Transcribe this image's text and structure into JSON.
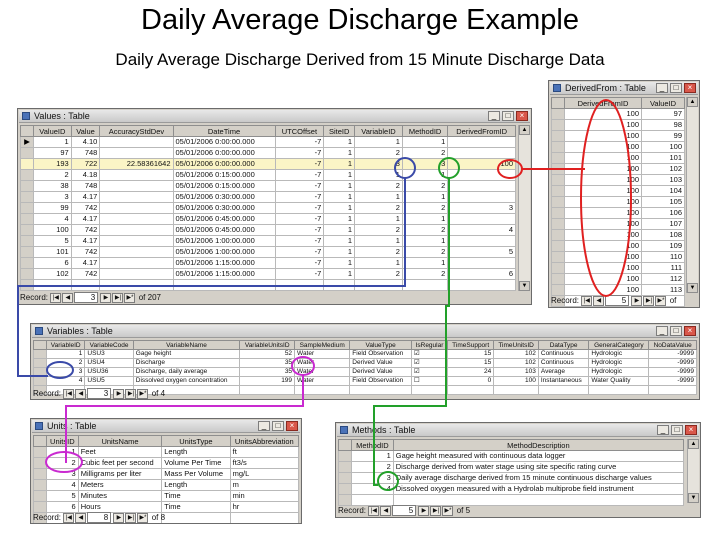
{
  "slide": {
    "title": "Daily Average Discharge Example",
    "subtitle": "Daily Average Discharge Derived from 15 Minute Discharge Data"
  },
  "colors": {
    "red": "#e02020",
    "blue": "#3a4aa8",
    "green": "#22a02a",
    "magenta": "#c92ad0",
    "highlight": "#fbf5c6"
  },
  "values_table": {
    "title": "Values : Table",
    "columns": [
      "ValueID",
      "Value",
      "AccuracyStdDev",
      "DateTime",
      "UTCOffset",
      "SiteID",
      "VariableID",
      "MethodID",
      "DerivedFromID"
    ],
    "rows": [
      {
        "sel": "▶",
        "c": [
          "1",
          "4.10",
          "",
          "05/01/2006 0:00:00.000",
          "-7",
          "1",
          "1",
          "1",
          ""
        ]
      },
      {
        "sel": "",
        "c": [
          "97",
          "748",
          "",
          "05/01/2006 0:00:00.000",
          "-7",
          "1",
          "2",
          "2",
          ""
        ]
      },
      {
        "sel": "",
        "c": [
          "193",
          "722",
          "22.58361642",
          "05/01/2006 0:00:00.000",
          "-7",
          "1",
          "3",
          "3",
          "100"
        ]
      },
      {
        "sel": "",
        "c": [
          "2",
          "4.18",
          "",
          "05/01/2006 0:15:00.000",
          "-7",
          "1",
          "1",
          "1",
          ""
        ]
      },
      {
        "sel": "",
        "c": [
          "38",
          "748",
          "",
          "05/01/2006 0:15:00.000",
          "-7",
          "1",
          "2",
          "2",
          ""
        ]
      },
      {
        "sel": "",
        "c": [
          "3",
          "4.17",
          "",
          "05/01/2006 0:30:00.000",
          "-7",
          "1",
          "1",
          "1",
          ""
        ]
      },
      {
        "sel": "",
        "c": [
          "99",
          "742",
          "",
          "05/01/2006 0:30:00.000",
          "-7",
          "1",
          "2",
          "2",
          "3"
        ]
      },
      {
        "sel": "",
        "c": [
          "4",
          "4.17",
          "",
          "05/01/2006 0:45:00.000",
          "-7",
          "1",
          "1",
          "1",
          ""
        ]
      },
      {
        "sel": "",
        "c": [
          "100",
          "742",
          "",
          "05/01/2006 0:45:00.000",
          "-7",
          "1",
          "2",
          "2",
          "4"
        ]
      },
      {
        "sel": "",
        "c": [
          "5",
          "4.17",
          "",
          "05/01/2006 1:00:00.000",
          "-7",
          "1",
          "1",
          "1",
          ""
        ]
      },
      {
        "sel": "",
        "c": [
          "101",
          "742",
          "",
          "05/01/2006 1:00:00.000",
          "-7",
          "1",
          "2",
          "2",
          "5"
        ]
      },
      {
        "sel": "",
        "c": [
          "6",
          "4.17",
          "",
          "05/01/2006 1:15:00.000",
          "-7",
          "1",
          "1",
          "1",
          ""
        ]
      },
      {
        "sel": "",
        "c": [
          "102",
          "742",
          "",
          "05/01/2006 1:15:00.000",
          "-7",
          "1",
          "2",
          "2",
          "6"
        ]
      }
    ],
    "nav": {
      "record_label": "Record:",
      "current": "3",
      "of_label": "of 207"
    }
  },
  "derived_table": {
    "title": "DerivedFrom : Table",
    "columns": [
      "DerivedFromID",
      "ValueID"
    ],
    "rows": [
      [
        "100",
        "97"
      ],
      [
        "100",
        "98"
      ],
      [
        "100",
        "99"
      ],
      [
        "100",
        "100"
      ],
      [
        "100",
        "101"
      ],
      [
        "100",
        "102"
      ],
      [
        "100",
        "103"
      ],
      [
        "100",
        "104"
      ],
      [
        "100",
        "105"
      ],
      [
        "100",
        "106"
      ],
      [
        "100",
        "107"
      ],
      [
        "100",
        "108"
      ],
      [
        "100",
        "109"
      ],
      [
        "100",
        "110"
      ],
      [
        "100",
        "111"
      ],
      [
        "100",
        "112"
      ],
      [
        "100",
        "113"
      ]
    ],
    "nav": {
      "record_label": "Record:",
      "current": "5",
      "of_label": "of"
    }
  },
  "variables_table": {
    "title": "Variables : Table",
    "columns": [
      "VariableID",
      "VariableCode",
      "VariableName",
      "VariableUnitsID",
      "SampleMedium",
      "ValueType",
      "IsRegular",
      "TimeSupport",
      "TimeUnitsID",
      "DataType",
      "GeneralCategory",
      "NoDataValue"
    ],
    "rows": [
      [
        "1",
        "USU3",
        "Gage height",
        "52",
        "Water",
        "Field Observation",
        "☑",
        "15",
        "102",
        "Continuous",
        "Hydrologic",
        "-9999"
      ],
      [
        "2",
        "USU4",
        "Discharge",
        "35",
        "Water",
        "Derived Value",
        "☑",
        "15",
        "102",
        "Continuous",
        "Hydrologic",
        "-9999"
      ],
      [
        "3",
        "USU36",
        "Discharge, daily average",
        "35",
        "Water",
        "Derived Value",
        "☑",
        "24",
        "103",
        "Average",
        "Hydrologic",
        "-9999"
      ],
      [
        "4",
        "USU5",
        "Dissolved oxygen concentration",
        "199",
        "Water",
        "Field Observation",
        "☐",
        "0",
        "100",
        "Instantaneous",
        "Water Quality",
        "-9999"
      ]
    ],
    "nav": {
      "record_label": "Record:",
      "current": "3",
      "of_label": "of 4"
    }
  },
  "units_table": {
    "title": "Units : Table",
    "columns": [
      "UnitsID",
      "UnitsName",
      "UnitsType",
      "UnitsAbbreviation"
    ],
    "rows": [
      [
        "1",
        "Feet",
        "Length",
        "ft"
      ],
      [
        "2",
        "Cubic feet per second",
        "Volume Per Time",
        "ft3/s"
      ],
      [
        "3",
        "Milligrams per liter",
        "Mass Per Volume",
        "mg/L"
      ],
      [
        "4",
        "Meters",
        "Length",
        "m"
      ],
      [
        "5",
        "Minutes",
        "Time",
        "min"
      ],
      [
        "6",
        "Hours",
        "Time",
        "hr"
      ]
    ],
    "nav": {
      "record_label": "Record:",
      "current": "8",
      "of_label": "of 8"
    }
  },
  "methods_table": {
    "title": "Methods : Table",
    "columns": [
      "MethodID",
      "MethodDescription"
    ],
    "rows": [
      [
        "1",
        "Gage height measured with continuous data logger"
      ],
      [
        "2",
        "Discharge derived from water stage using site specific rating curve"
      ],
      [
        "3",
        "Daily average discharge derived from 15 minute continuous discharge values"
      ],
      [
        "4",
        "Dissolved oxygen measured with a Hydrolab multiprobe field instrument"
      ]
    ],
    "nav": {
      "record_label": "Record:",
      "current": "5",
      "of_label": "of 5"
    }
  }
}
